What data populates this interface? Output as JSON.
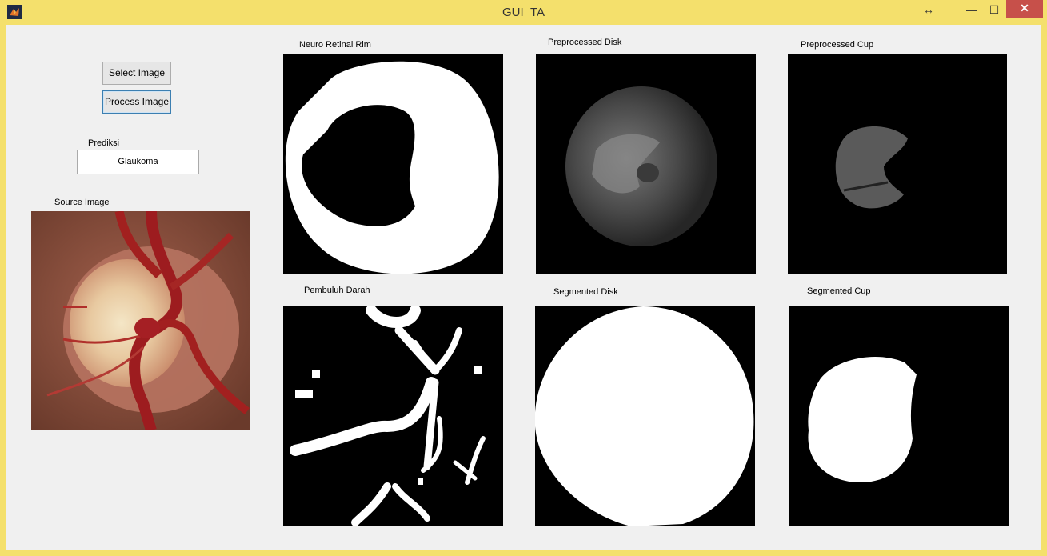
{
  "window": {
    "title": "GUI_TA",
    "restore_glyph": "↔",
    "minimize_glyph": "—",
    "maximize_glyph": "☐",
    "close_glyph": "✕"
  },
  "controls": {
    "select_label": "Select Image",
    "process_label": "Process Image",
    "prediction_label": "Prediksi",
    "prediction_value": "Glaukoma"
  },
  "panels": {
    "source": "Source Image",
    "rim": "Neuro Retinal Rim",
    "pre_disk": "Preprocessed Disk",
    "pre_cup": "Preprocessed Cup",
    "vessels": "Pembuluh Darah",
    "seg_disk": "Segmented Disk",
    "seg_cup": "Segmented Cup"
  },
  "colors": {
    "title_bar": "#f4e06c",
    "close_button": "#c7504a",
    "panel_background": "#000000",
    "mask_foreground": "#ffffff"
  }
}
